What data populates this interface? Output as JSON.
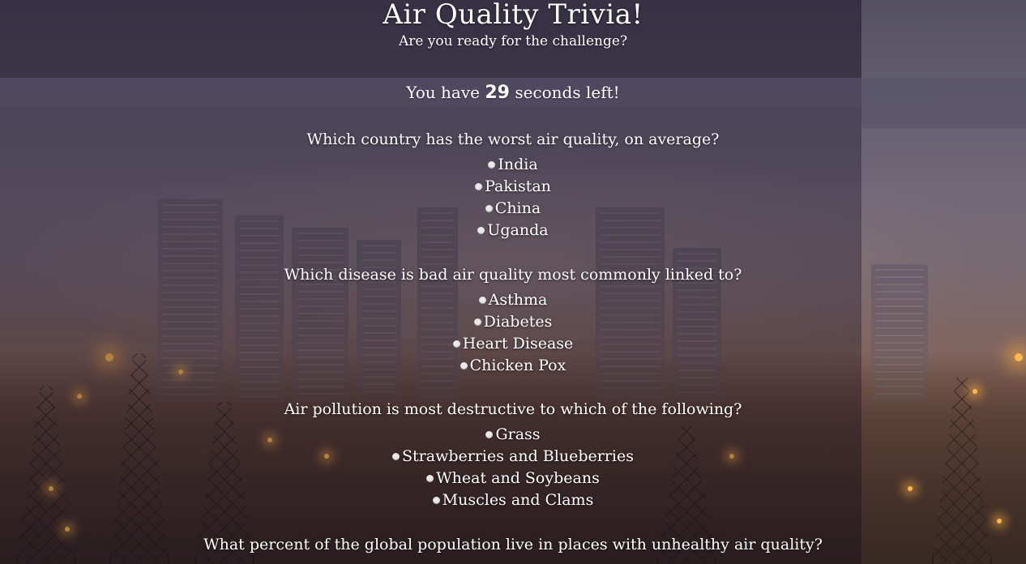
{
  "header": {
    "title": "Air Quality Trivia!",
    "subtitle": "Are you ready for the challenge?"
  },
  "timer": {
    "prefix": "You have",
    "seconds": "29",
    "suffix": "seconds left!"
  },
  "questions": [
    {
      "text": "Which country has the worst air quality, on average?",
      "options": [
        "India",
        "Pakistan",
        "China",
        "Uganda"
      ]
    },
    {
      "text": "Which disease is bad air quality most commonly linked to?",
      "options": [
        "Asthma",
        "Diabetes",
        "Heart Disease",
        "Chicken Pox"
      ]
    },
    {
      "text": "Air pollution is most destructive to which of the following?",
      "options": [
        "Grass",
        "Strawberries and Blueberries",
        "Wheat and Soybeans",
        "Muscles and Clams"
      ]
    },
    {
      "text": "What percent of the global population live in places with unhealthy air quality?",
      "options": []
    }
  ],
  "colors": {
    "text": "#ffffff",
    "radio": "#e9e9e9",
    "panel": "#55506a"
  },
  "icons": {
    "option_marker": "radio-button-icon"
  }
}
